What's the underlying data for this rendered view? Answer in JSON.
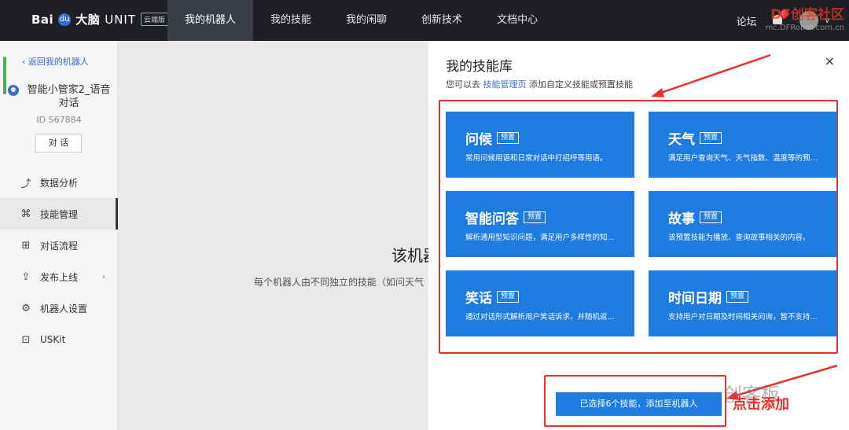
{
  "nav": {
    "logo_brand": "Bai",
    "logo_paw": "du",
    "logo_suffix": "大脑",
    "logo_unit": "UNIT",
    "logo_badge": "云端版",
    "tabs": [
      {
        "label": "我的机器人",
        "active": true
      },
      {
        "label": "我的技能",
        "active": false
      },
      {
        "label": "我的闲聊",
        "active": false
      },
      {
        "label": "创新技术",
        "active": false
      },
      {
        "label": "文档中心",
        "active": false
      }
    ],
    "forum": "论坛",
    "notif_count": "8",
    "watermark_top": "DF创客社区",
    "watermark_top_sub": "mc.DFRobot.com.cn"
  },
  "sidebar": {
    "back_label": "返回我的机器人",
    "robot_name": "智能小管家2_语音对话",
    "robot_id": "ID S67884",
    "chat_button": "对 话",
    "menu": [
      {
        "label": "数据分析",
        "icon": "chart-icon",
        "glyph": "⤴",
        "active": false
      },
      {
        "label": "技能管理",
        "icon": "skill-icon",
        "glyph": "⌘",
        "active": true
      },
      {
        "label": "对话流程",
        "icon": "flow-icon",
        "glyph": "⊞",
        "active": false
      },
      {
        "label": "发布上线",
        "icon": "publish-icon",
        "glyph": "⇪",
        "active": false,
        "arrow": "›"
      },
      {
        "label": "机器人设置",
        "icon": "settings-icon",
        "glyph": "⚙",
        "active": false
      },
      {
        "label": "USKit",
        "icon": "uskit-icon",
        "glyph": "⊡",
        "active": false
      }
    ]
  },
  "main": {
    "title": "该机器人",
    "desc": "每个机器人由不同独立的技能（如问天气"
  },
  "drawer": {
    "title": "我的技能库",
    "close": "×",
    "sub_prefix": "您可以去 ",
    "sub_link": "技能管理页",
    "sub_suffix": " 添加自定义技能或预置技能",
    "skills": [
      {
        "name": "问候",
        "tag": "预置",
        "desc": "常用问候用语和日常对话中打招呼等用语。"
      },
      {
        "name": "天气",
        "tag": "预置",
        "desc": "满足用户查询天气、天气指数、温度等的预..."
      },
      {
        "name": "智能问答",
        "tag": "预置",
        "desc": "解析通用型知识问题，满足用户多样性的知..."
      },
      {
        "name": "故事",
        "tag": "预置",
        "desc": "该预置技能为播放、查询故事相关的内容。"
      },
      {
        "name": "笑话",
        "tag": "预置",
        "desc": "通过对话形式解析用户笑话诉求，并随机返..."
      },
      {
        "name": "时间日期",
        "tag": "预置",
        "desc": "支持用户对日期及时间相关问询，暂不支持..."
      }
    ],
    "add_button": "已选择6个技能，添加至机器人"
  },
  "annotations": {
    "click_add": "点击添加",
    "watermark": "创客板",
    "color": "#e8312a"
  }
}
